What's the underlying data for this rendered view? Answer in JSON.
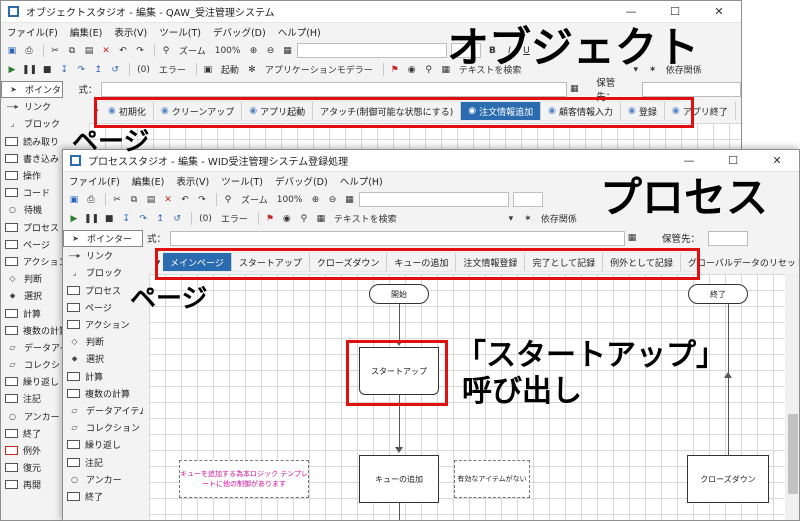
{
  "object_window": {
    "title": "オブジェクトスタジオ - 編集 - QAW_受注管理システム",
    "menu": [
      "ファイル(F)",
      "編集(E)",
      "表示(V)",
      "ツール(T)",
      "デバッグ(D)",
      "ヘルプ(H)"
    ],
    "toolbar1": {
      "zoom_label": "ズーム",
      "zoom_value": "100%"
    },
    "toolbar2": {
      "step_count": "(0)",
      "error_label": "エラー",
      "launch_label": "起動",
      "app_modeler_label": "アプリケーションモデラー",
      "text_search": "テキストを検索",
      "dependency_label": "依存関係"
    },
    "expr_label": "式：",
    "store_label": "保管先：",
    "tabs": [
      "初期化",
      "クリーンアップ",
      "アプリ起動",
      "アタッチ(制御可能な状態にする)",
      "注文情報追加",
      "顧客情報入力",
      "登録",
      "アプリ終了"
    ],
    "active_tab": "注文情報追加",
    "palette": [
      "ポインター",
      "リンク",
      "ブロック",
      "読み取り",
      "書き込み",
      "操作",
      "コード",
      "待機",
      "プロセス",
      "ページ",
      "アクション",
      "判断",
      "選択",
      "計算",
      "複数の計算",
      "データアイテム",
      "コレクション",
      "繰り返し",
      "注記",
      "アンカー",
      "終了",
      "例外",
      "復元",
      "再開"
    ]
  },
  "process_window": {
    "title": "プロセススタジオ - 編集 - WID受注管理システム登録処理",
    "menu": [
      "ファイル(F)",
      "編集(E)",
      "表示(V)",
      "ツール(T)",
      "デバッグ(D)",
      "ヘルプ(H)"
    ],
    "toolbar1": {
      "zoom_label": "ズーム",
      "zoom_value": "100%"
    },
    "toolbar2": {
      "step_count": "(0)",
      "error_label": "エラー",
      "text_search": "テキストを検索",
      "dependency_label": "依存関係"
    },
    "expr_label": "式：",
    "store_label": "保管先：",
    "tabs": [
      "メインページ",
      "スタートアップ",
      "クローズダウン",
      "キューの追加",
      "注文情報登録",
      "完了として記録",
      "例外として記録",
      "グローバルデータのリセット"
    ],
    "active_tab": "メインページ",
    "palette": [
      "ポインター",
      "リンク",
      "ブロック",
      "プロセス",
      "ページ",
      "アクション",
      "判断",
      "選択",
      "計算",
      "複数の計算",
      "データアイテム",
      "コレクション",
      "繰り返し",
      "注記",
      "アンカー",
      "終了"
    ],
    "flow": {
      "start": "開始",
      "end": "終了",
      "startup_page": "スタートアップ",
      "queue_add": "キューの追加",
      "no_item": "有効なアイテムがない",
      "closedown": "クローズダウン",
      "note": "キューを追加する為本ロジック テンプレートに他の制御があります"
    }
  },
  "annotations": {
    "object_heading": "オブジェクト",
    "process_heading": "プロセス",
    "page_label_1": "ページ",
    "page_label_2": "ページ",
    "startup_call_line1": "「スタートアップ」",
    "startup_call_line2": "呼び出し"
  },
  "colors": {
    "active_tab": "#2b6cb0",
    "highlight": "#e01010",
    "note_text": "#d0109e"
  }
}
